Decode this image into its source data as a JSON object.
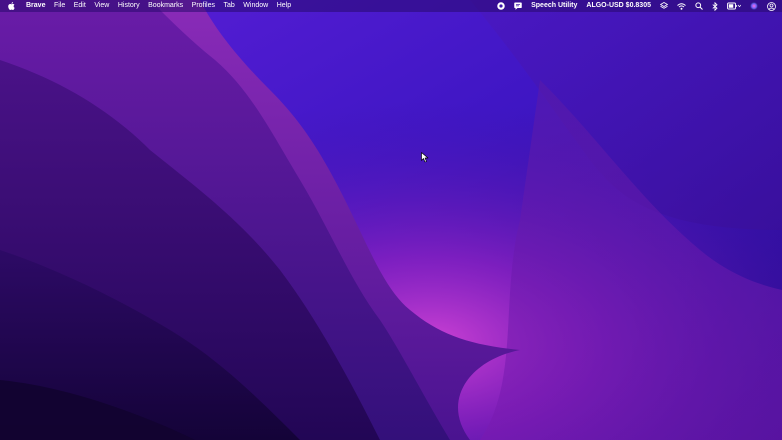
{
  "menubar": {
    "app_name": "Brave",
    "menus": [
      "File",
      "Edit",
      "View",
      "History",
      "Bookmarks",
      "Profiles",
      "Tab",
      "Window",
      "Help"
    ],
    "status": {
      "speech_utility": "Speech Utility",
      "ticker": "ALGO-USD $0.8305"
    }
  },
  "icons": {
    "apple": "apple-icon",
    "record": "record-icon",
    "speech": "speech-bubble-icon",
    "layers": "layers-icon",
    "wifi": "wifi-icon",
    "search": "search-icon",
    "bluetooth": "bluetooth-icon",
    "control_center": "control-center-icon",
    "siri": "siri-icon",
    "user": "user-icon",
    "cursor": "mouse-pointer-icon"
  },
  "colors": {
    "wallpaper_top": "#3a14c8",
    "wallpaper_mid": "#6a1ab0",
    "wallpaper_glow": "#c23ac8",
    "wallpaper_dark": "#1c0650",
    "menubar_text": "#ffffff"
  }
}
